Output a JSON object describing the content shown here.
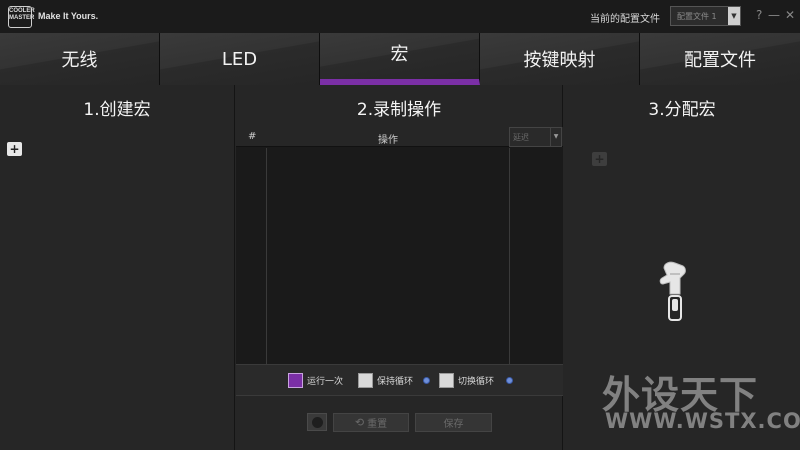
{
  "topbar": {
    "logo_badge": "COOLER MASTER",
    "slogan": "Make It Yours.",
    "profile_label": "当前的配置文件",
    "profile_value": "配置文件 1",
    "help_glyph": "?",
    "minimize_glyph": "—",
    "close_glyph": "✕"
  },
  "tabs": [
    {
      "label": "无线",
      "active": false
    },
    {
      "label": "LED",
      "active": false
    },
    {
      "label": "宏",
      "active": true
    },
    {
      "label": "按键映射",
      "active": false
    },
    {
      "label": "配置文件",
      "active": false
    }
  ],
  "panels": {
    "create": {
      "title": "1.创建宏",
      "add_glyph": "+"
    },
    "record": {
      "title": "2.录制操作",
      "col_index": "#",
      "col_action": "操作",
      "delay_value": "延迟",
      "options": {
        "run_once": "运行一次",
        "keep_loop": "保持循环",
        "toggle_loop": "切换循环"
      },
      "reset_label": "重置",
      "save_label": "保存"
    },
    "assign": {
      "title": "3.分配宏",
      "add_glyph": "+"
    }
  },
  "watermark": {
    "cn": "外设天下",
    "en": "WWW.WSTX.COM"
  },
  "colors": {
    "accent": "#7b2fa6",
    "info": "#6f8fd8"
  }
}
